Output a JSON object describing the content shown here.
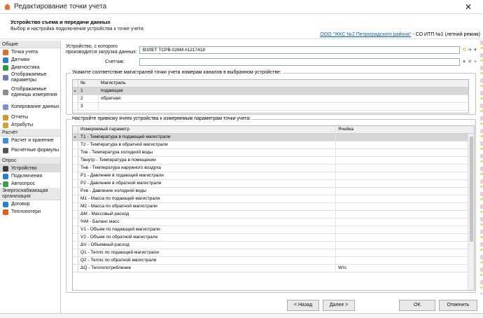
{
  "window": {
    "title": "Редактирование точки учета"
  },
  "header": {
    "title": "Устройство съема и передачи данных",
    "subtitle": "Выбор и настройка подключения устройства к точке учета",
    "org_link": "ООО \"ЖКС №2 Петроградского района\"",
    "org_rest": " - СО ИТП №1 (летний режим)"
  },
  "sidebar": {
    "groups": [
      {
        "label": "Общие",
        "items": [
          {
            "label": "Точка учета",
            "icon": "house-icon",
            "color": "#e36b2c"
          },
          {
            "label": "Датчики",
            "icon": "sensor-icon",
            "color": "#2a7fd4"
          },
          {
            "label": "Диагностика",
            "icon": "pulse-icon",
            "color": "#2e9b44"
          },
          {
            "label": "Отображаемые параметры",
            "icon": "list-icon",
            "color": "#6d7fb3"
          },
          {
            "label": "Отображаемые единицы измерения",
            "icon": "units-icon",
            "color": "#8a8a8a"
          },
          {
            "label": "Копирование данных",
            "icon": "copy-icon",
            "color": "#7b94c6"
          },
          {
            "label": "Отчеты",
            "icon": "report-icon",
            "color": "#c99a2e"
          },
          {
            "label": "Атрибуты",
            "icon": "attr-icon",
            "color": "#d0a030"
          }
        ]
      },
      {
        "label": "Расчёт",
        "items": [
          {
            "label": "Расчет и хранение",
            "icon": "calc-icon",
            "color": "#3d8edb"
          },
          {
            "label": "Расчётные формулы",
            "icon": "formula-icon",
            "color": "#555555"
          }
        ]
      },
      {
        "label": "Опрос",
        "items": [
          {
            "label": "Устройство",
            "icon": "device-icon",
            "color": "#3a3a3a",
            "selected": true
          },
          {
            "label": "Подключения",
            "icon": "globe-icon",
            "color": "#2a7fd4"
          },
          {
            "label": "Автоопрос",
            "icon": "auto-icon",
            "color": "#3e9b4f",
            "expandable": true
          }
        ]
      },
      {
        "label": "Энергоснабжающая организация",
        "items": [
          {
            "label": "Договор",
            "icon": "contract-icon",
            "color": "#2a7fd4"
          },
          {
            "label": "Теплопотери",
            "icon": "fire-icon",
            "color": "#e85a1a"
          }
        ]
      }
    ]
  },
  "device": {
    "label": "Устройство, с которого производится загрузка данных:",
    "value": "ВЗЛЕТ ТСРВ-026М #1217418",
    "counter_label": "Счетчик:",
    "counter_value": ""
  },
  "mains": {
    "legend": "Укажите соответствие магистралей точки учета номерам каналов в выбранном устройстве:",
    "columns": [
      "№",
      "Магистраль"
    ],
    "rows": [
      {
        "num": "1",
        "name": "подающая"
      },
      {
        "num": "2",
        "name": "обратная"
      },
      {
        "num": "3",
        "name": ""
      }
    ]
  },
  "cells": {
    "legend": "Настройте привязку ячеек устройства к измеряемым параметрам точки учета:",
    "columns": [
      "Измеряемый параметр",
      "Ячейка"
    ],
    "rows": [
      {
        "param": "T1 - Температура в подающей магистрали",
        "cell": ""
      },
      {
        "param": "T2 - Температура в обратной магистрали",
        "cell": ""
      },
      {
        "param": "Тхв - Температура холодной воды",
        "cell": ""
      },
      {
        "param": "Твнутр - Температура в помещении",
        "cell": ""
      },
      {
        "param": "Тнв - Температура наружного воздуха",
        "cell": ""
      },
      {
        "param": "P1 - Давление в подающей магистрали",
        "cell": ""
      },
      {
        "param": "P2 - Давление в обратной магистрали",
        "cell": ""
      },
      {
        "param": "Рхв - Давление холодной воды",
        "cell": ""
      },
      {
        "param": "M1 - Масса по подающей магистрали",
        "cell": ""
      },
      {
        "param": "M2 - Масса по обратной магистрали",
        "cell": ""
      },
      {
        "param": "ΔM - Массовый расход",
        "cell": ""
      },
      {
        "param": "%M - Баланс масс",
        "cell": ""
      },
      {
        "param": "V1 - Объем по подающей магистрали",
        "cell": ""
      },
      {
        "param": "V2 - Объем по обратной магистрали",
        "cell": ""
      },
      {
        "param": "ΔV - Объемный расход",
        "cell": ""
      },
      {
        "param": "Q1 - Тепло по подающей магистрали",
        "cell": ""
      },
      {
        "param": "Q2 - Тепло по обратной магистрали",
        "cell": ""
      },
      {
        "param": "ΔQ - Теплопотребление",
        "cell": "Wтс"
      }
    ]
  },
  "footer": {
    "back": "< Назад",
    "next": "Далее >",
    "ok": "OK",
    "cancel": "Отменить"
  }
}
